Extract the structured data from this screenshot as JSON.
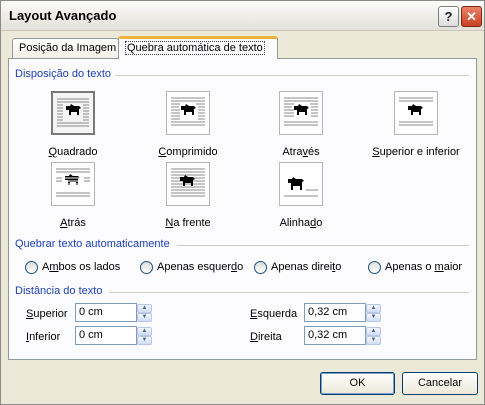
{
  "dialog": {
    "title": "Layout Avançado",
    "help_icon": "question-mark-icon",
    "close_icon": "close-x-icon"
  },
  "tabs": [
    {
      "label": "Posição da Imagem",
      "active": false
    },
    {
      "label": "Quebra automática de texto",
      "active": true
    }
  ],
  "wrapping_style": {
    "heading": "Disposição do texto",
    "options": [
      {
        "key": "square",
        "access_key": "Q",
        "label_rest": "uadrado",
        "icon": "square-wrap-icon",
        "selected": true
      },
      {
        "key": "tight",
        "access_key": "C",
        "label_rest": "omprimido",
        "icon": "tight-wrap-icon",
        "selected": false
      },
      {
        "key": "through",
        "access_key_before": "Atra",
        "access_key": "v",
        "label_rest": "és",
        "icon": "through-wrap-icon",
        "selected": false
      },
      {
        "key": "top_bottom",
        "access_key": "S",
        "label_rest": "uperior e inferior",
        "icon": "top-bottom-wrap-icon",
        "selected": false
      },
      {
        "key": "behind",
        "access_key": "A",
        "label_rest": "trás",
        "icon": "behind-text-icon",
        "selected": false
      },
      {
        "key": "in_front",
        "access_key": "N",
        "label_rest": "a frente",
        "icon": "in-front-text-icon",
        "selected": false
      },
      {
        "key": "inline",
        "access_key_before": "Alinha",
        "access_key": "d",
        "label_rest": "o",
        "icon": "inline-text-icon",
        "selected": false
      }
    ]
  },
  "wrap_text": {
    "heading": "Quebrar texto automaticamente",
    "options": [
      {
        "access_key": "m",
        "label_before": "A",
        "label_rest": "bos os lados",
        "selected": false
      },
      {
        "label_before": "Apenas esquer",
        "access_key": "d",
        "label_rest": "o",
        "selected": false
      },
      {
        "label_before": "Apenas direi",
        "access_key": "t",
        "label_rest": "o",
        "selected": false
      },
      {
        "label_before": "Apenas o ",
        "access_key": "m",
        "label_rest": "aior",
        "selected": false
      }
    ]
  },
  "distance": {
    "heading": "Distância do texto",
    "fields": [
      {
        "key": "top",
        "access_key": "S",
        "label_rest": "uperior",
        "value": "0 cm"
      },
      {
        "key": "bottom",
        "access_key": "I",
        "label_rest": "nferior",
        "value": "0 cm"
      },
      {
        "key": "left",
        "access_key": "E",
        "label_rest": "squerda",
        "value": "0,32 cm"
      },
      {
        "key": "right",
        "access_key": "D",
        "label_rest": "ireita",
        "value": "0,32 cm"
      }
    ]
  },
  "buttons": {
    "ok": "OK",
    "cancel": "Cancelar"
  },
  "colors": {
    "heading_blue": "#1b3fb2",
    "tab_highlight": "#f2b33d",
    "dialog_bg": "#ece9d8"
  }
}
